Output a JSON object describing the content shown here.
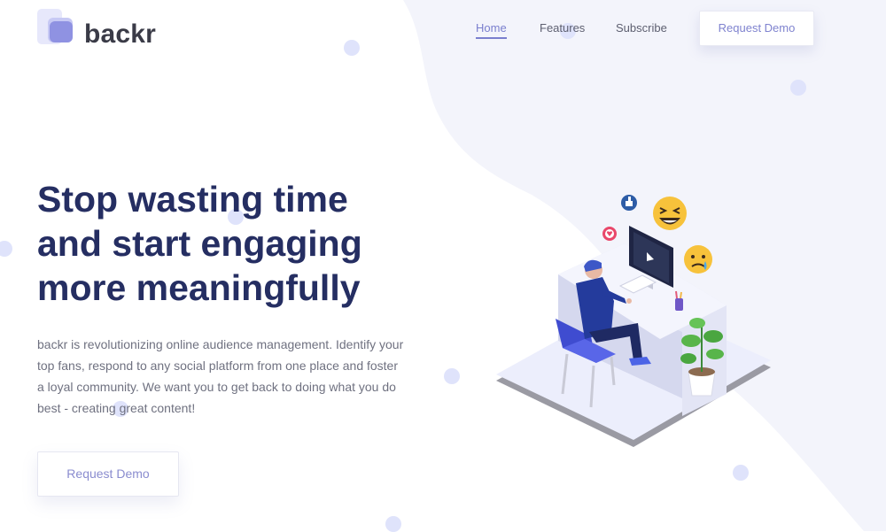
{
  "brand": {
    "name": "backr"
  },
  "nav": {
    "items": [
      {
        "label": "Home",
        "active": true
      },
      {
        "label": "Features"
      },
      {
        "label": "Subscribe"
      }
    ],
    "cta_label": "Request Demo"
  },
  "hero": {
    "title_lines": [
      "Stop wasting time",
      "and start engaging",
      "more meaningfully"
    ],
    "description": "backr is revolutionizing online audience management. Identify your top fans, respond to any social platform from one place and foster a loyal community. We want you to get back to doing what you do best - creating great content!",
    "cta_label": "Request Demo"
  },
  "colors": {
    "accent": "#7a7fce",
    "heading": "#252e62",
    "background_blob": "#f3f4fb"
  },
  "illustration": {
    "icons": [
      "thumbs-up-icon",
      "laughing-emoji-icon",
      "heart-icon",
      "sad-emoji-icon"
    ]
  }
}
